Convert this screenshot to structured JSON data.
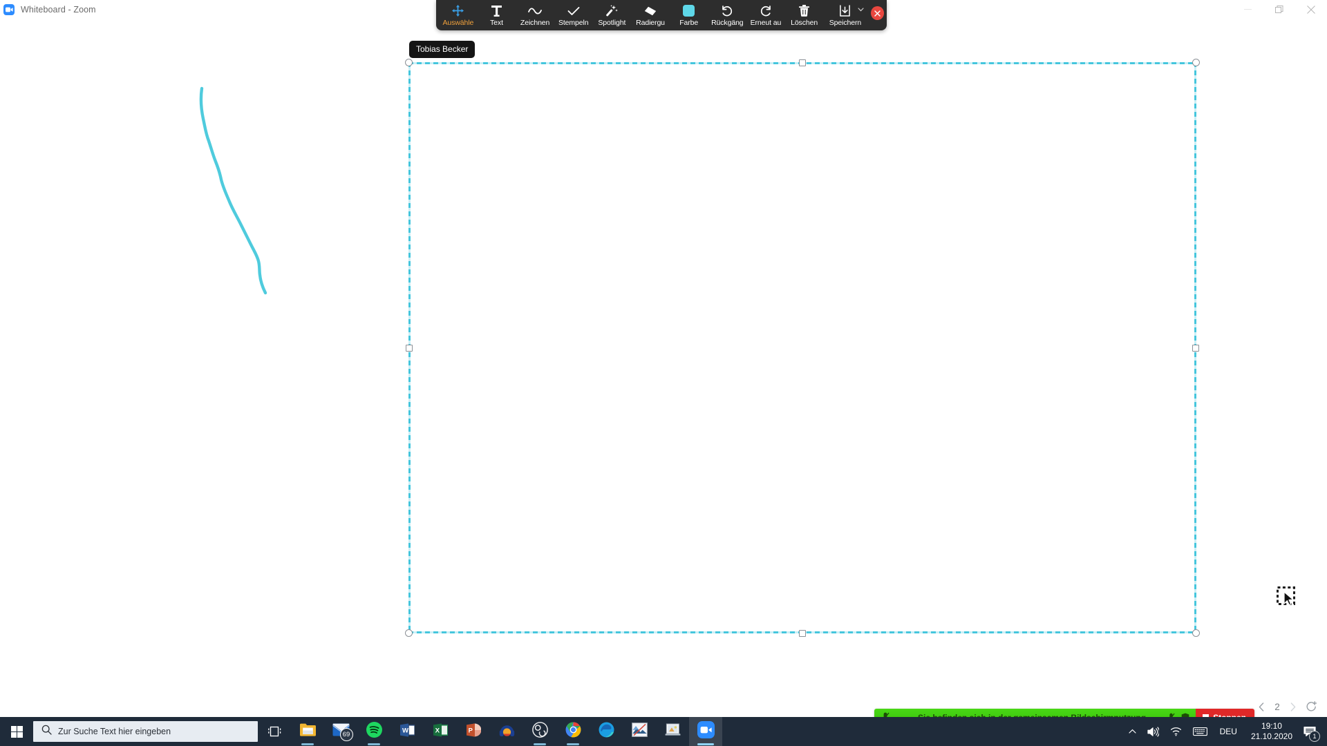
{
  "window": {
    "title": "Whiteboard - Zoom",
    "app_icon": "zoom-camera-icon",
    "controls": {
      "minimize": "minimize-icon",
      "maximize": "restore-icon",
      "close": "close-icon"
    }
  },
  "toolbar": {
    "tools": [
      {
        "id": "auswaehlen",
        "label": "Auswähle",
        "icon": "move-select-icon",
        "active": true
      },
      {
        "id": "text",
        "label": "Text",
        "icon": "text-T-icon",
        "active": false
      },
      {
        "id": "zeichnen",
        "label": "Zeichnen",
        "icon": "draw-squiggle-icon",
        "active": false
      },
      {
        "id": "stempeln",
        "label": "Stempeln",
        "icon": "stamp-check-icon",
        "active": false
      },
      {
        "id": "spotlight",
        "label": "Spotlight",
        "icon": "spotlight-wand-icon",
        "active": false
      },
      {
        "id": "radiergummi",
        "label": "Radiergu",
        "icon": "eraser-icon",
        "active": false
      },
      {
        "id": "farbe",
        "label": "Farbe",
        "icon": "color-swatch-icon",
        "active": false
      },
      {
        "id": "rueckgaengig",
        "label": "Rückgäng",
        "icon": "undo-arrow-icon",
        "active": false
      },
      {
        "id": "erneut",
        "label": "Erneut au",
        "icon": "redo-arrow-icon",
        "active": false
      },
      {
        "id": "loeschen",
        "label": "Löschen",
        "icon": "trash-icon",
        "active": false
      },
      {
        "id": "speichern",
        "label": "Speichern",
        "icon": "save-download-icon",
        "active": false
      }
    ],
    "save_caret": "chevron-down-icon",
    "close_label": "close-toolbar-icon",
    "color_swatch": "#5ed7e8",
    "active_color": "#f0a13c"
  },
  "canvas": {
    "name_tag": "Tobias Becker",
    "stroke_color": "#4fcbdd",
    "selection": {
      "color": "#45c6dd",
      "handles": [
        "top-left",
        "top-center",
        "top-right",
        "middle-left",
        "middle-right",
        "bottom-left",
        "bottom-center",
        "bottom-right"
      ]
    },
    "cursor": "marquee-select-cursor"
  },
  "page_nav": {
    "prev": "chevron-left-icon",
    "page": "2",
    "next": "chevron-right-icon",
    "new_page": "add-page-icon"
  },
  "share_bar": {
    "message": "Sie befinden sich in der gemeinsamen Bildschirmnutzung",
    "mic_icon": "microphone-muted-icon",
    "shield_icon": "shield-icon",
    "stop_label": "Stoppen",
    "green": "#3ec90e",
    "red": "#e02828"
  },
  "taskbar": {
    "start": "windows-start-icon",
    "search_placeholder": "Zur Suche Text hier eingeben",
    "search_icon": "search-icon",
    "taskview_icon": "task-view-icon",
    "apps": [
      {
        "name": "file-explorer",
        "icon": "folder-icon"
      },
      {
        "name": "mail",
        "icon": "mail-icon",
        "badge": "69"
      },
      {
        "name": "spotify",
        "icon": "spotify-icon"
      },
      {
        "name": "word",
        "icon": "word-icon"
      },
      {
        "name": "excel",
        "icon": "excel-icon"
      },
      {
        "name": "powerpoint",
        "icon": "powerpoint-icon"
      },
      {
        "name": "headphones-app",
        "icon": "headphones-icon"
      },
      {
        "name": "obs-studio",
        "icon": "obs-icon"
      },
      {
        "name": "chrome",
        "icon": "chrome-icon"
      },
      {
        "name": "edge",
        "icon": "edge-icon"
      },
      {
        "name": "photo-editor",
        "icon": "photo-icon"
      },
      {
        "name": "presentation-viewer",
        "icon": "slideshow-icon"
      },
      {
        "name": "zoom",
        "icon": "zoom-camera-icon",
        "active": true
      }
    ],
    "tray": {
      "chevron": "chevron-up-icon",
      "volume": "speaker-icon",
      "network": "wifi-icon",
      "keyboard": "keyboard-icon",
      "language": "DEU",
      "time": "19:10",
      "date": "21.10.2020",
      "notifications_icon": "notification-icon",
      "notifications_count": "1"
    }
  }
}
